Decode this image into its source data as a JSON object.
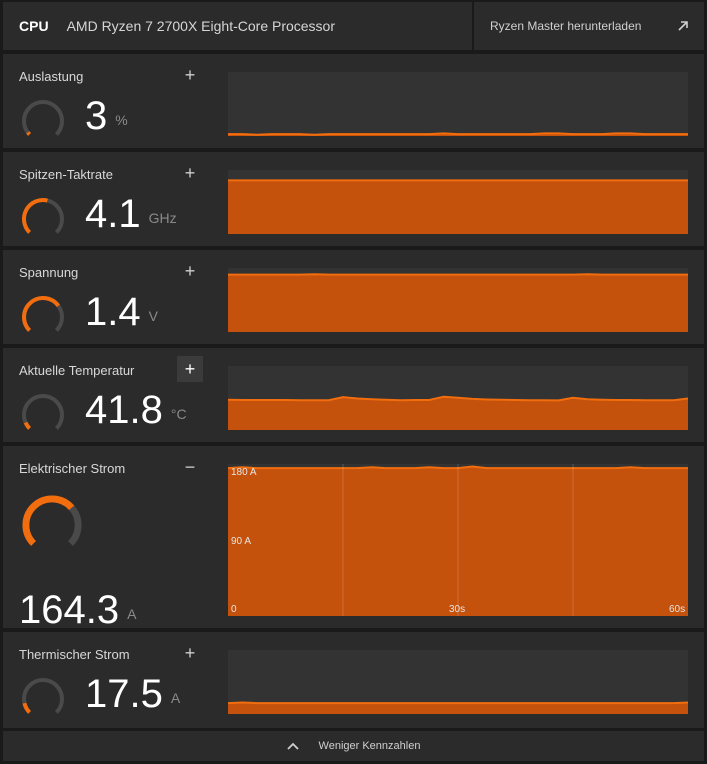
{
  "header": {
    "cpu_label": "CPU",
    "cpu_name": "AMD Ryzen 7 2700X Eight-Core Processor",
    "download_label": "Ryzen Master herunterladen",
    "download_icon": "external-link-icon"
  },
  "colors": {
    "accent": "#f26d0d",
    "chart_fill": "#c4510c",
    "panel": "#2b2b2b",
    "chart_bg": "#333333"
  },
  "metrics": [
    {
      "id": "auslastung",
      "title": "Auslastung",
      "value": "3",
      "unit": "%",
      "toggle": "+",
      "gauge": 0.03,
      "series": [
        3,
        3,
        2,
        3,
        3,
        3,
        2,
        3,
        3,
        3,
        3,
        3,
        3,
        3,
        3,
        4,
        3,
        3,
        3,
        3,
        3,
        3,
        4,
        4,
        3,
        3,
        3,
        4,
        4,
        3,
        3,
        3,
        3
      ]
    },
    {
      "id": "spitzen-taktrate",
      "title": "Spitzen-Taktrate",
      "value": "4.1",
      "unit": "GHz",
      "toggle": "+",
      "gauge": 0.55,
      "series": [
        4.1,
        4.1,
        4.1,
        4.1,
        4.1,
        4.1,
        4.1,
        4.1,
        4.1,
        4.1,
        4.1,
        4.1,
        4.1,
        4.1,
        4.1,
        4.1,
        4.1,
        4.1,
        4.1,
        4.1,
        4.1,
        4.1,
        4.1,
        4.1,
        4.1,
        4.1,
        4.1,
        4.1,
        4.1,
        4.1,
        4.1,
        4.1,
        4.1
      ]
    },
    {
      "id": "spannung",
      "title": "Spannung",
      "value": "1.4",
      "unit": "V",
      "toggle": "+",
      "gauge": 0.7,
      "series": [
        1.4,
        1.4,
        1.4,
        1.4,
        1.4,
        1.4,
        1.41,
        1.4,
        1.4,
        1.4,
        1.4,
        1.4,
        1.4,
        1.4,
        1.4,
        1.4,
        1.4,
        1.4,
        1.4,
        1.4,
        1.4,
        1.4,
        1.4,
        1.4,
        1.4,
        1.41,
        1.4,
        1.4,
        1.4,
        1.4,
        1.4,
        1.4,
        1.4
      ]
    },
    {
      "id": "aktuelle-temperatur",
      "title": "Aktuelle Temperatur",
      "value": "41.8",
      "unit": "°C",
      "toggle": "+",
      "gauge": 0.08,
      "series": [
        41.5,
        41.4,
        41.4,
        41.4,
        41.4,
        41.3,
        41.3,
        41.3,
        43.0,
        42.2,
        41.8,
        41.5,
        41.3,
        41.4,
        41.4,
        43.2,
        42.6,
        42.0,
        41.7,
        41.5,
        41.4,
        41.3,
        41.3,
        41.2,
        42.6,
        41.8,
        41.5,
        41.4,
        41.4,
        41.3,
        41.3,
        41.3,
        42.2
      ]
    }
  ],
  "current": {
    "title": "Elektrischer Strom",
    "value": "164.3",
    "unit": "A",
    "toggle": "−",
    "gauge": 0.68,
    "chart_data": {
      "type": "area",
      "y_labels": [
        "180 A",
        "90 A",
        "0"
      ],
      "x_labels": [
        "30s",
        "60s"
      ],
      "ylim": [
        0,
        180
      ],
      "xlim": [
        0,
        60
      ],
      "series": [
        {
          "values": [
            180,
            181,
            180,
            180,
            180,
            180,
            180,
            180,
            180,
            180,
            181,
            180,
            180,
            180,
            181,
            180,
            180,
            182,
            180,
            180,
            180,
            180,
            180,
            180,
            180,
            180,
            180,
            180,
            181,
            180,
            180,
            180,
            180
          ]
        }
      ]
    }
  },
  "thermal": {
    "title": "Thermischer Strom",
    "value": "17.5",
    "unit": "A",
    "toggle": "+",
    "gauge": 0.12,
    "series": [
      17,
      18,
      17,
      17,
      17,
      17,
      17,
      17,
      17,
      17,
      17,
      17,
      17,
      17,
      17,
      17,
      17,
      17,
      17,
      17,
      17,
      17,
      17,
      17,
      17,
      17,
      17,
      17,
      17,
      17,
      17,
      17,
      18
    ]
  },
  "footer": {
    "label": "Weniger Kennzahlen",
    "icon": "chevron-up-icon"
  }
}
